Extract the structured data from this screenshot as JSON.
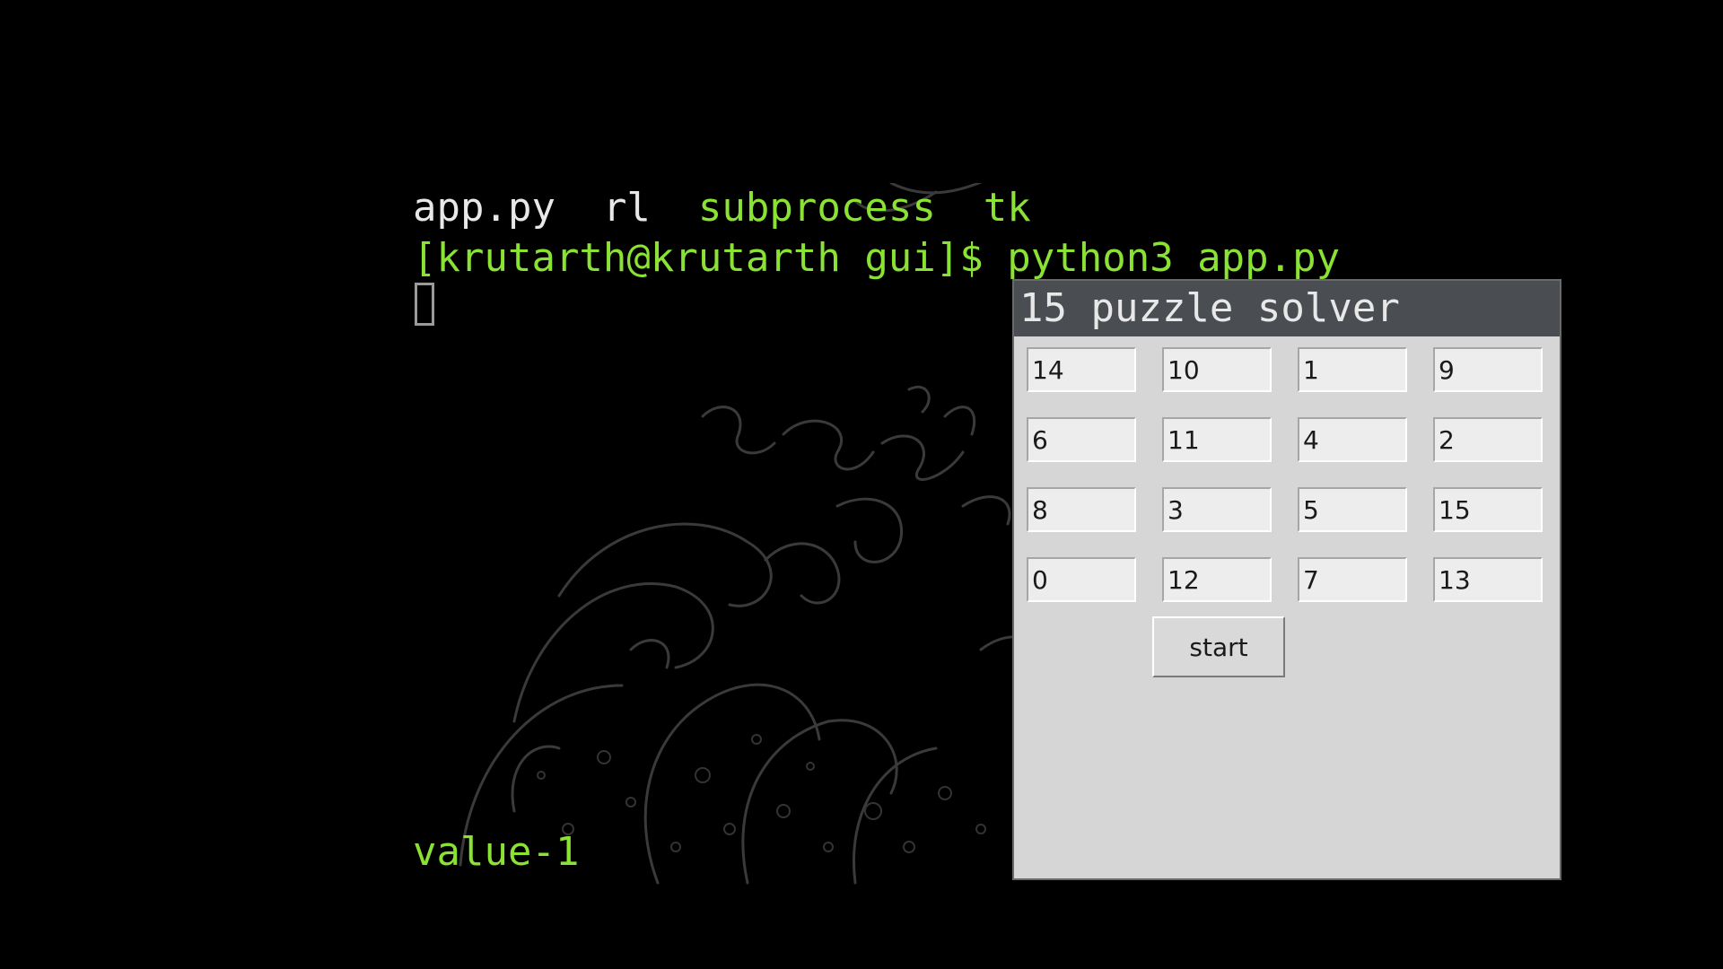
{
  "terminal": {
    "files": {
      "app": "app.py",
      "rl": "rl",
      "subprocess": "subprocess",
      "tk": "tk"
    },
    "prompt": "[krutarth@krutarth gui]$ python3 app.py",
    "output_value": "value-1"
  },
  "tk_window": {
    "title": "15 puzzle solver",
    "tiles": [
      "14",
      "10",
      "1",
      "9",
      "6",
      "11",
      "4",
      "2",
      "8",
      "3",
      "5",
      "15",
      "0",
      "12",
      "7",
      "13"
    ],
    "start_label": "start"
  },
  "colors": {
    "terminal_background": "#000000",
    "terminal_green": "#8ae234",
    "terminal_white": "#e8e8e8",
    "window_title_bar": "#4a4e52",
    "window_background": "#d6d6d6"
  }
}
